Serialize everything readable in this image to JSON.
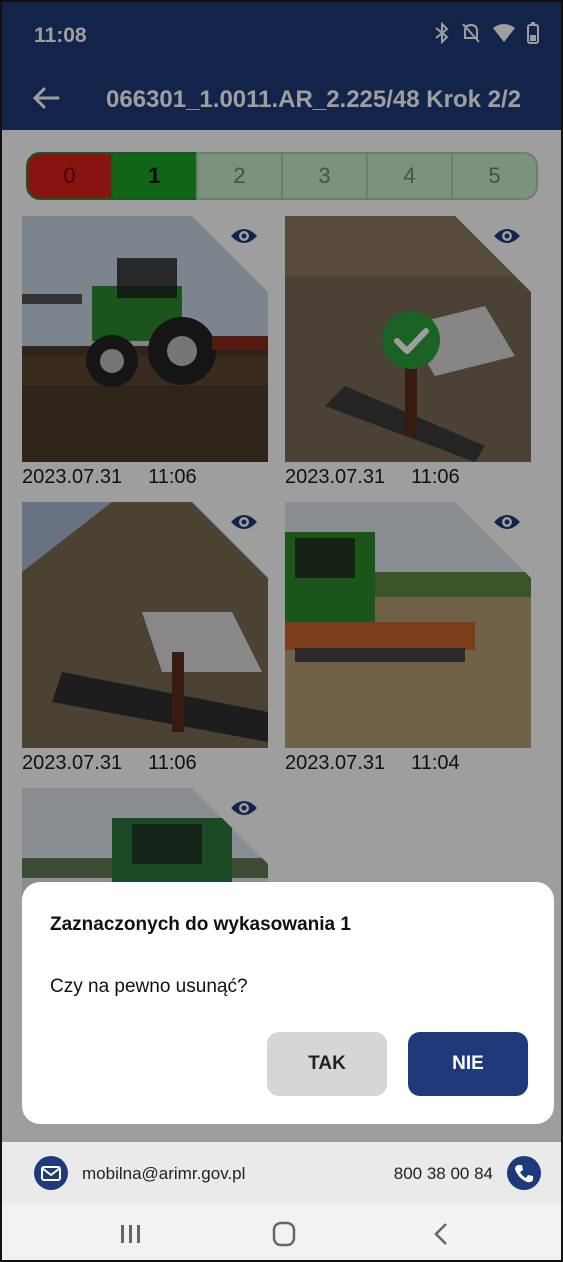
{
  "status_bar": {
    "time": "11:08",
    "icons": [
      "bluetooth-icon",
      "mute-icon",
      "wifi-icon",
      "battery-icon"
    ]
  },
  "app_bar": {
    "back_icon": "arrow-left-icon",
    "title": "066301_1.0011.AR_2.225/48 Krok 2/2"
  },
  "steps": [
    {
      "label": "0",
      "state": "red"
    },
    {
      "label": "1",
      "state": "active"
    },
    {
      "label": "2",
      "state": "inactive"
    },
    {
      "label": "3",
      "state": "inactive"
    },
    {
      "label": "4",
      "state": "inactive"
    },
    {
      "label": "5",
      "state": "inactive"
    }
  ],
  "photos": [
    {
      "date": "2023.07.31",
      "time": "11:06",
      "selected": false
    },
    {
      "date": "2023.07.31",
      "time": "11:06",
      "selected": true
    },
    {
      "date": "2023.07.31",
      "time": "11:06",
      "selected": false
    },
    {
      "date": "2023.07.31",
      "time": "11:04",
      "selected": false
    },
    {
      "date": "",
      "time": "",
      "selected": false
    }
  ],
  "dialog": {
    "title": "Zaznaczonych do wykasowania 1",
    "question": "Czy na pewno usunąć?",
    "yes_label": "TAK",
    "no_label": "NIE"
  },
  "footer": {
    "email": "mobilna@arimr.gov.pl",
    "phone": "800 38 00 84"
  },
  "colors": {
    "primary": "#1f3a7a",
    "step_red": "#d8221d",
    "step_green": "#1aa324",
    "check_green": "#2aa03a"
  }
}
